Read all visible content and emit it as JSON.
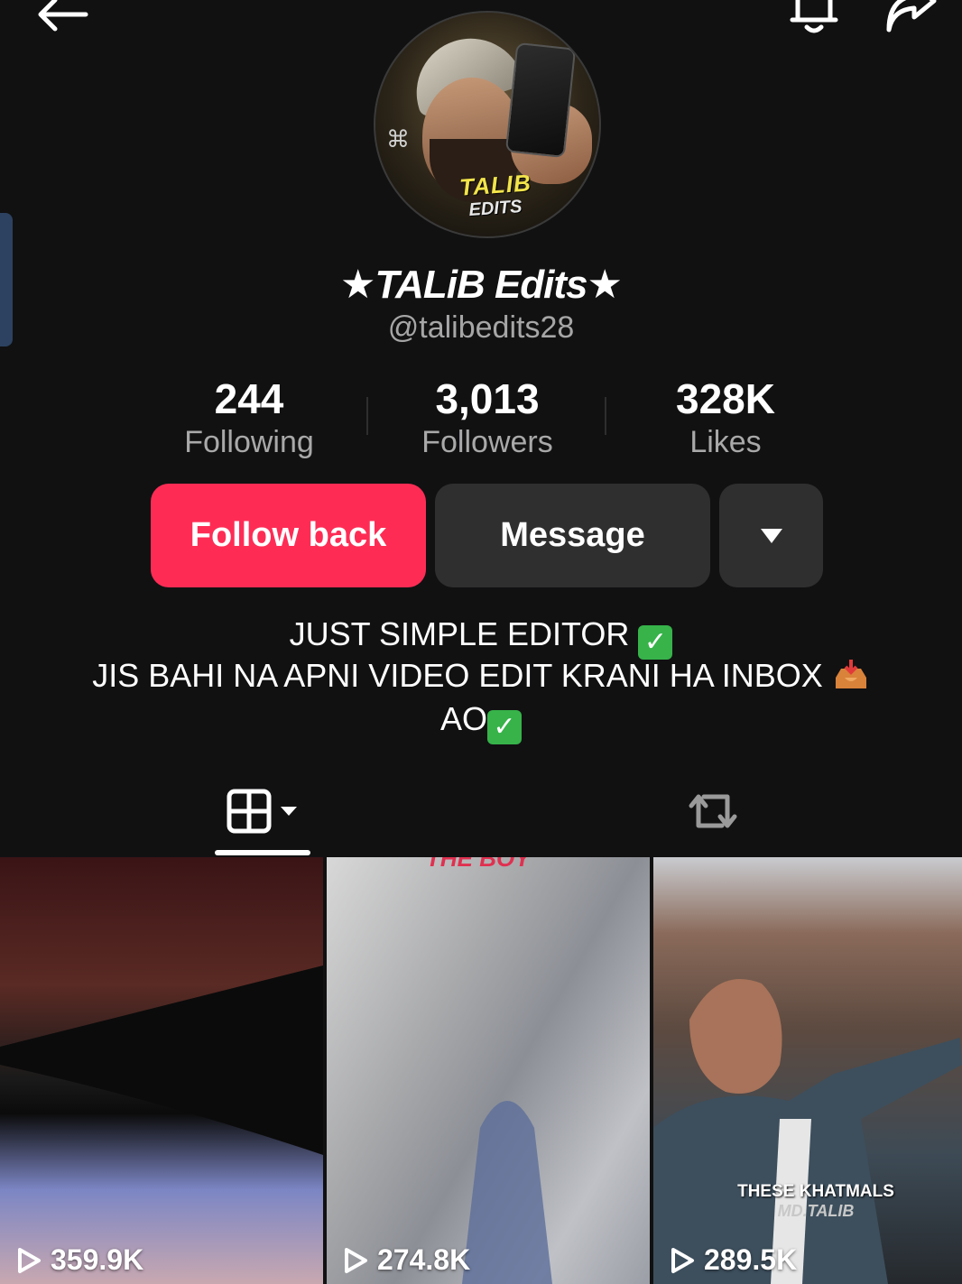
{
  "header": {
    "back_icon": "arrow-left-icon",
    "bell_icon": "bell-icon",
    "share_icon": "share-arrow-icon"
  },
  "profile": {
    "avatar_text_line1": "TALIB",
    "avatar_text_line2": "EDITS",
    "display_name": "★TALiB Edits★",
    "handle": "@talibedits28"
  },
  "stats": [
    {
      "value": "244",
      "label": "Following"
    },
    {
      "value": "3,013",
      "label": "Followers"
    },
    {
      "value": "328K",
      "label": "Likes"
    }
  ],
  "actions": {
    "follow_label": "Follow back",
    "message_label": "Message",
    "more_icon": "caret-down-icon"
  },
  "bio": {
    "line1": "JUST SIMPLE EDITOR",
    "line2": "JIS BAHI NA APNI VIDEO EDIT KRANI HA INBOX",
    "line3": "AO"
  },
  "tabs": {
    "videos_icon": "grid-icon",
    "reposts_icon": "repost-icon"
  },
  "videos": [
    {
      "views": "359.9K",
      "caption_top": "",
      "caption_line1": "",
      "caption_line2": ""
    },
    {
      "views": "274.8K",
      "caption_top": "THE BOY",
      "caption_line1": "",
      "caption_line2": ""
    },
    {
      "views": "289.5K",
      "caption_top": "",
      "caption_line1": "THESE KHATMALS",
      "caption_line2": "MD.TALIB"
    }
  ],
  "colors": {
    "background": "#111112",
    "follow_button": "#fe2c55",
    "secondary_button": "#2f2f2f",
    "muted_text": "#a6a6a6"
  }
}
